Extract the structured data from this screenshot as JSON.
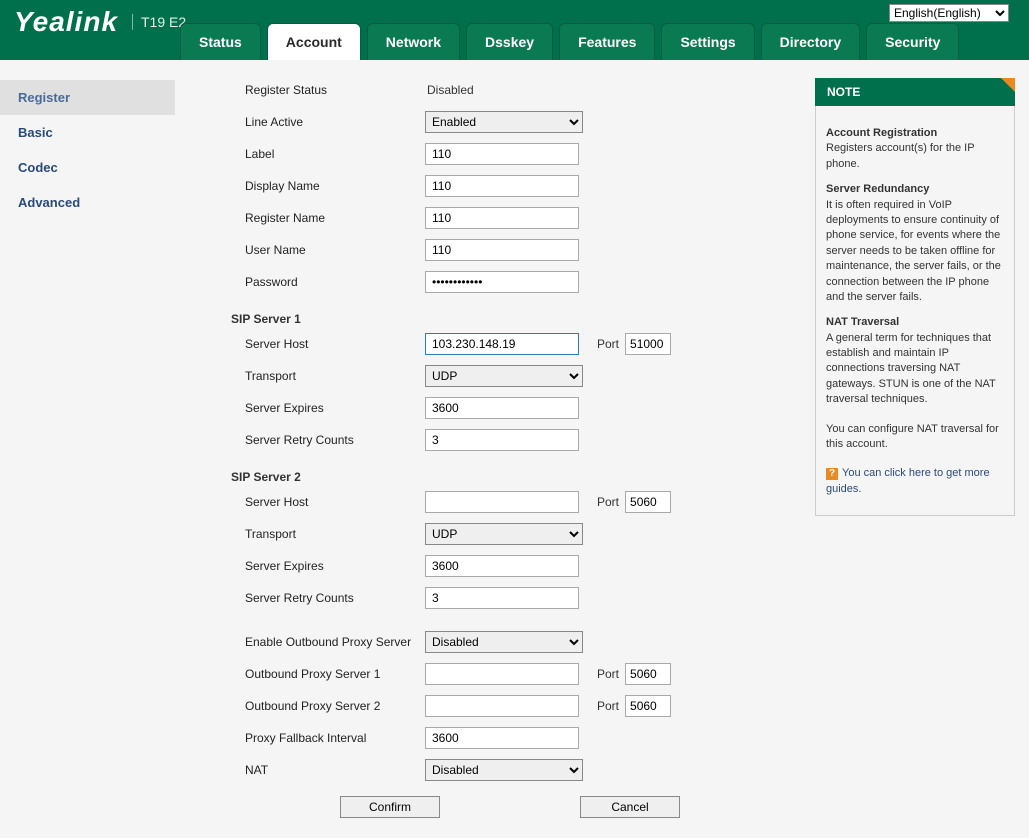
{
  "header": {
    "brand": "Yealink",
    "model": "T19 E2",
    "language": "English(English)"
  },
  "tabs": [
    "Status",
    "Account",
    "Network",
    "Dsskey",
    "Features",
    "Settings",
    "Directory",
    "Security"
  ],
  "active_tab": "Account",
  "sidebar": {
    "items": [
      "Register",
      "Basic",
      "Codec",
      "Advanced"
    ],
    "active": "Register"
  },
  "form": {
    "register_status": {
      "label": "Register Status",
      "value": "Disabled"
    },
    "line_active": {
      "label": "Line Active",
      "value": "Enabled"
    },
    "label_field": {
      "label": "Label",
      "value": "110"
    },
    "display_name": {
      "label": "Display Name",
      "value": "110"
    },
    "register_name": {
      "label": "Register Name",
      "value": "110"
    },
    "user_name": {
      "label": "User Name",
      "value": "110"
    },
    "password": {
      "label": "Password",
      "value": "••••••••••••"
    },
    "sip1": {
      "title": "SIP Server 1",
      "host": {
        "label": "Server Host",
        "value": "103.230.148.19",
        "port_label": "Port",
        "port": "51000"
      },
      "transport": {
        "label": "Transport",
        "value": "UDP"
      },
      "expires": {
        "label": "Server Expires",
        "value": "3600"
      },
      "retry": {
        "label": "Server Retry Counts",
        "value": "3"
      }
    },
    "sip2": {
      "title": "SIP Server 2",
      "host": {
        "label": "Server Host",
        "value": "",
        "port_label": "Port",
        "port": "5060"
      },
      "transport": {
        "label": "Transport",
        "value": "UDP"
      },
      "expires": {
        "label": "Server Expires",
        "value": "3600"
      },
      "retry": {
        "label": "Server Retry Counts",
        "value": "3"
      }
    },
    "outbound": {
      "enable": {
        "label": "Enable Outbound Proxy Server",
        "value": "Disabled"
      },
      "s1": {
        "label": "Outbound Proxy Server 1",
        "value": "",
        "port_label": "Port",
        "port": "5060"
      },
      "s2": {
        "label": "Outbound Proxy Server 2",
        "value": "",
        "port_label": "Port",
        "port": "5060"
      },
      "fallback": {
        "label": "Proxy Fallback Interval",
        "value": "3600"
      },
      "nat": {
        "label": "NAT",
        "value": "Disabled"
      }
    },
    "buttons": {
      "confirm": "Confirm",
      "cancel": "Cancel"
    }
  },
  "note": {
    "title": "NOTE",
    "sections": [
      {
        "title": "Account Registration",
        "body": "Registers account(s) for the IP phone."
      },
      {
        "title": "Server Redundancy",
        "body": "It is often required in VoIP deployments to ensure continuity of phone service, for events where the server needs to be taken offline for maintenance, the server fails, or the connection between the IP phone and the server fails."
      },
      {
        "title": "NAT Traversal",
        "body": "A general term for techniques that establish and maintain IP connections traversing NAT gateways. STUN is one of the NAT traversal techniques."
      }
    ],
    "extra": "You can configure NAT traversal for this account.",
    "link": "You can click here to get more guides."
  }
}
